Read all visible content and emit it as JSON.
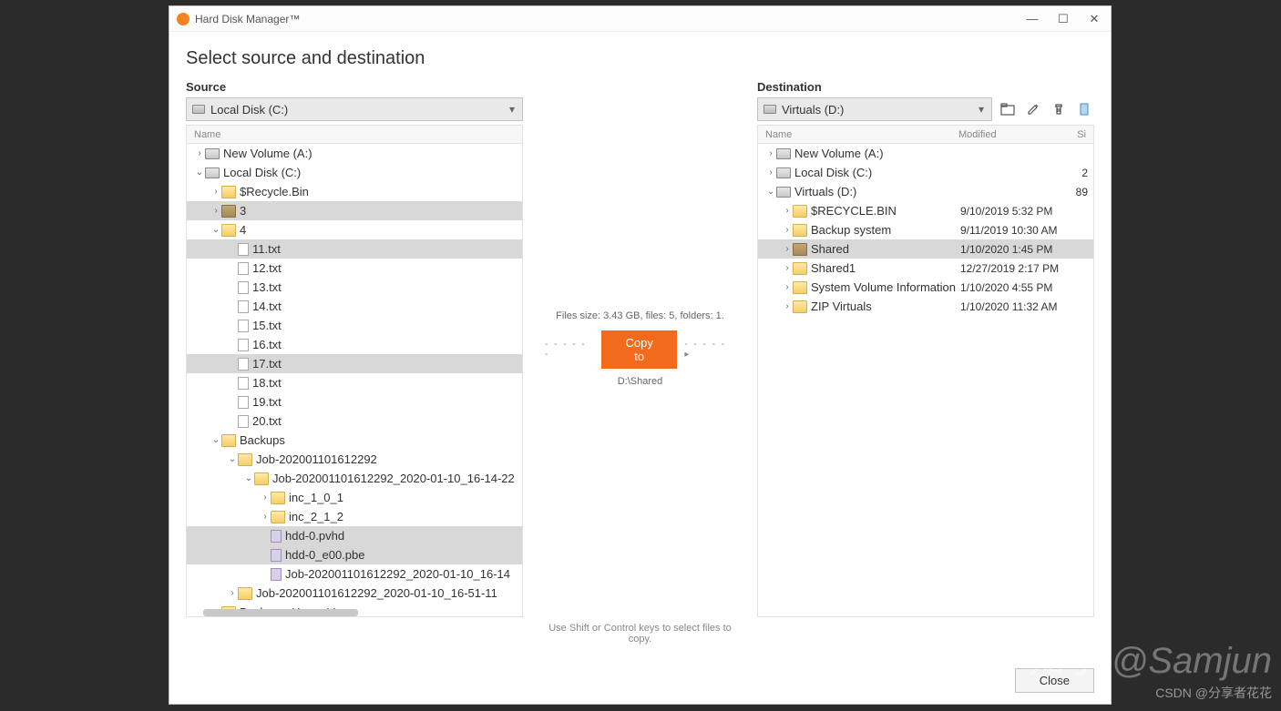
{
  "window": {
    "title": "Hard Disk Manager™"
  },
  "page": {
    "title": "Select source and destination"
  },
  "source": {
    "label": "Source",
    "selected_drive": "Local Disk (C:)",
    "header_name": "Name",
    "tree": [
      {
        "indent": 0,
        "exp": ">",
        "icon": "drive",
        "label": "New Volume (A:)"
      },
      {
        "indent": 0,
        "exp": "v",
        "icon": "drive",
        "label": "Local Disk (C:)"
      },
      {
        "indent": 1,
        "exp": ">",
        "icon": "folder",
        "label": "$Recycle.Bin"
      },
      {
        "indent": 1,
        "exp": ">",
        "icon": "folder-dark",
        "label": "3",
        "selected": true
      },
      {
        "indent": 1,
        "exp": "v",
        "icon": "folder",
        "label": "4"
      },
      {
        "indent": 2,
        "exp": "",
        "icon": "file",
        "label": "11.txt",
        "selected": true
      },
      {
        "indent": 2,
        "exp": "",
        "icon": "file",
        "label": "12.txt"
      },
      {
        "indent": 2,
        "exp": "",
        "icon": "file",
        "label": "13.txt"
      },
      {
        "indent": 2,
        "exp": "",
        "icon": "file",
        "label": "14.txt"
      },
      {
        "indent": 2,
        "exp": "",
        "icon": "file",
        "label": "15.txt"
      },
      {
        "indent": 2,
        "exp": "",
        "icon": "file",
        "label": "16.txt"
      },
      {
        "indent": 2,
        "exp": "",
        "icon": "file",
        "label": "17.txt",
        "selected": true
      },
      {
        "indent": 2,
        "exp": "",
        "icon": "file",
        "label": "18.txt"
      },
      {
        "indent": 2,
        "exp": "",
        "icon": "file",
        "label": "19.txt"
      },
      {
        "indent": 2,
        "exp": "",
        "icon": "file",
        "label": "20.txt"
      },
      {
        "indent": 1,
        "exp": "v",
        "icon": "folder",
        "label": "Backups"
      },
      {
        "indent": 2,
        "exp": "v",
        "icon": "folder",
        "label": "Job-202001101612292"
      },
      {
        "indent": 3,
        "exp": "v",
        "icon": "folder",
        "label": "Job-202001101612292_2020-01-10_16-14-22"
      },
      {
        "indent": 4,
        "exp": ">",
        "icon": "folder",
        "label": "inc_1_0_1"
      },
      {
        "indent": 4,
        "exp": ">",
        "icon": "folder",
        "label": "inc_2_1_2"
      },
      {
        "indent": 4,
        "exp": "",
        "icon": "file-purple",
        "label": "hdd-0.pvhd",
        "selected": true
      },
      {
        "indent": 4,
        "exp": "",
        "icon": "file-purple",
        "label": "hdd-0_e00.pbe",
        "selected": true
      },
      {
        "indent": 4,
        "exp": "",
        "icon": "file-purple",
        "label": "Job-202001101612292_2020-01-10_16-14"
      },
      {
        "indent": 2,
        "exp": ">",
        "icon": "folder",
        "label": "Job-202001101612292_2020-01-10_16-51-11"
      },
      {
        "indent": 1,
        "exp": ">",
        "icon": "folder",
        "label": "Backups_Hyper-V"
      }
    ]
  },
  "destination": {
    "label": "Destination",
    "selected_drive": "Virtuals (D:)",
    "header_name": "Name",
    "header_modified": "Modified",
    "header_size": "Si",
    "tree": [
      {
        "indent": 0,
        "exp": ">",
        "icon": "drive",
        "label": "New Volume (A:)"
      },
      {
        "indent": 0,
        "exp": ">",
        "icon": "drive",
        "label": "Local Disk (C:)",
        "size": "2"
      },
      {
        "indent": 0,
        "exp": "v",
        "icon": "drive",
        "label": "Virtuals (D:)",
        "size": "89"
      },
      {
        "indent": 1,
        "exp": ">",
        "icon": "folder",
        "label": "$RECYCLE.BIN",
        "modified": "9/10/2019 5:32 PM"
      },
      {
        "indent": 1,
        "exp": ">",
        "icon": "folder",
        "label": "Backup system",
        "modified": "9/11/2019 10:30 AM"
      },
      {
        "indent": 1,
        "exp": ">",
        "icon": "folder-dark",
        "label": "Shared",
        "modified": "1/10/2020 1:45 PM",
        "selected": true
      },
      {
        "indent": 1,
        "exp": ">",
        "icon": "folder",
        "label": "Shared1",
        "modified": "12/27/2019 2:17 PM"
      },
      {
        "indent": 1,
        "exp": ">",
        "icon": "folder",
        "label": "System Volume Information",
        "modified": "1/10/2020 4:55 PM"
      },
      {
        "indent": 1,
        "exp": ">",
        "icon": "folder",
        "label": "ZIP Virtuals",
        "modified": "1/10/2020 11:32 AM"
      }
    ]
  },
  "middle": {
    "stats": "Files size: 3.43 GB, files: 5, folders: 1.",
    "copy_label": "Copy to",
    "dest_path": "D:\\Shared",
    "hint": "Use Shift or Control keys to select files to copy."
  },
  "footer": {
    "close_label": "Close"
  },
  "watermark": {
    "main": "知乎 @Samjun",
    "sub": "CSDN @分享者花花"
  }
}
